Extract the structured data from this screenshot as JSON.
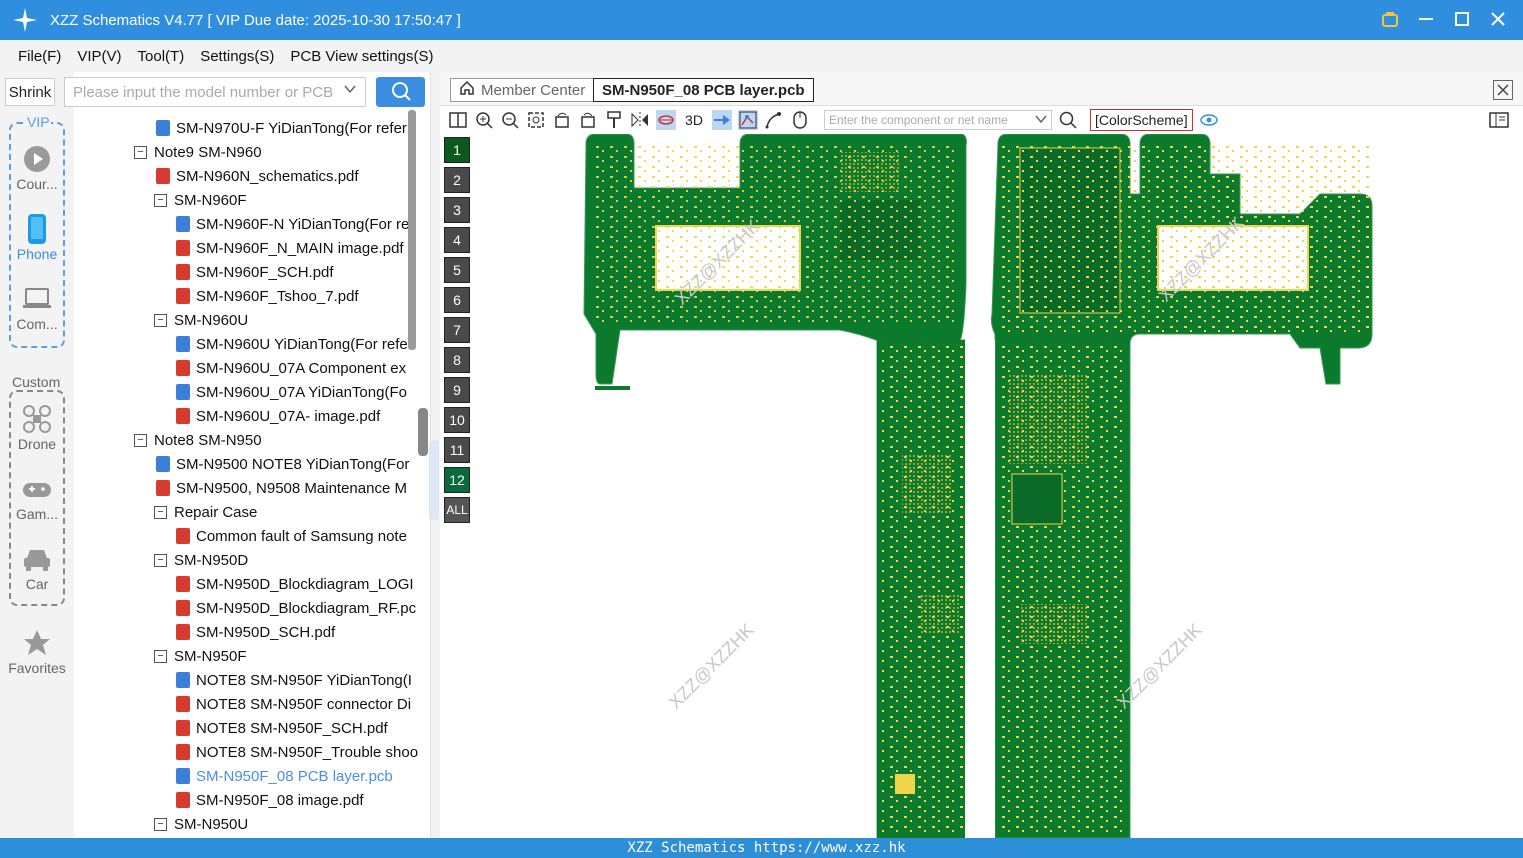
{
  "window": {
    "title": "XZZ Schematics V4.77 [ VIP Due date: 2025-10-30 17:50:47 ]",
    "titlebar_color": "#2f8fde"
  },
  "menu": [
    "File(F)",
    "VIP(V)",
    "Tool(T)",
    "Settings(S)",
    "PCB View settings(S)"
  ],
  "sidebar": {
    "shrink_label": "Shrink",
    "vip_label": "VIP",
    "custom_label": "Custom",
    "items": [
      {
        "label": "Cour...",
        "icon": "play-circle-icon"
      },
      {
        "label": "Phone",
        "icon": "phone-icon",
        "active": true
      },
      {
        "label": "Com...",
        "icon": "laptop-icon"
      },
      {
        "label": "Drone",
        "icon": "drone-icon"
      },
      {
        "label": "Gam...",
        "icon": "gamepad-icon"
      },
      {
        "label": "Car",
        "icon": "car-icon"
      },
      {
        "label": "Favorites",
        "icon": "star-icon"
      }
    ]
  },
  "search": {
    "placeholder": "Please input the model number or PCB"
  },
  "tree": [
    {
      "level": 1,
      "type": "pcb",
      "label": "SM-N970U-F YiDianTong(For refer"
    },
    {
      "level": 0,
      "type": "folder",
      "label": "Note9 SM-N960"
    },
    {
      "level": 1,
      "type": "pdf",
      "label": "SM-N960N_schematics.pdf"
    },
    {
      "level": 1,
      "type": "folder",
      "label": "SM-N960F"
    },
    {
      "level": 2,
      "type": "pcb",
      "label": "SM-N960F-N YiDianTong(For re"
    },
    {
      "level": 2,
      "type": "pdf",
      "label": "SM-N960F_N_MAIN image.pdf"
    },
    {
      "level": 2,
      "type": "pdf",
      "label": "SM-N960F_SCH.pdf"
    },
    {
      "level": 2,
      "type": "pdf",
      "label": "SM-N960F_Tshoo_7.pdf"
    },
    {
      "level": 1,
      "type": "folder",
      "label": "SM-N960U"
    },
    {
      "level": 2,
      "type": "pcb",
      "label": "SM-N960U YiDianTong(For refe"
    },
    {
      "level": 2,
      "type": "pdf",
      "label": "SM-N960U_07A Component ex"
    },
    {
      "level": 2,
      "type": "pcb",
      "label": "SM-N960U_07A YiDianTong(Fo"
    },
    {
      "level": 2,
      "type": "pdf",
      "label": "SM-N960U_07A- image.pdf"
    },
    {
      "level": 0,
      "type": "folder",
      "label": "Note8 SM-N950"
    },
    {
      "level": 1,
      "type": "pcb",
      "label": "SM-N9500 NOTE8 YiDianTong(For"
    },
    {
      "level": 1,
      "type": "pdf",
      "label": "SM-N9500, N9508 Maintenance M"
    },
    {
      "level": 1,
      "type": "folder",
      "label": "Repair Case"
    },
    {
      "level": 2,
      "type": "pdf",
      "label": "Common fault of Samsung note"
    },
    {
      "level": 1,
      "type": "folder",
      "label": "SM-N950D"
    },
    {
      "level": 2,
      "type": "pdf",
      "label": "SM-N950D_Blockdiagram_LOGI"
    },
    {
      "level": 2,
      "type": "pdf",
      "label": "SM-N950D_Blockdiagram_RF.pc"
    },
    {
      "level": 2,
      "type": "pdf",
      "label": "SM-N950D_SCH.pdf"
    },
    {
      "level": 1,
      "type": "folder",
      "label": "SM-N950F"
    },
    {
      "level": 2,
      "type": "pcb",
      "label": "NOTE8 SM-N950F YiDianTong(I"
    },
    {
      "level": 2,
      "type": "pdf",
      "label": "NOTE8 SM-N950F connector Di"
    },
    {
      "level": 2,
      "type": "pdf",
      "label": "NOTE8 SM-N950F_SCH.pdf"
    },
    {
      "level": 2,
      "type": "pdf",
      "label": "NOTE8 SM-N950F_Trouble shoo"
    },
    {
      "level": 2,
      "type": "pcb",
      "label": "SM-N950F_08 PCB layer.pcb",
      "active": true
    },
    {
      "level": 2,
      "type": "pdf",
      "label": "SM-N950F_08 image.pdf"
    },
    {
      "level": 1,
      "type": "folder",
      "label": "SM-N950U"
    }
  ],
  "tabs": {
    "home_label": "Member Center",
    "active_label": "SM-N950F_08 PCB layer.pcb"
  },
  "toolbar": {
    "label_3d": "3D",
    "component_placeholder": "Enter the component or net name",
    "colorscheme_label": "[ColorScheme]"
  },
  "layers": [
    "1",
    "2",
    "3",
    "4",
    "5",
    "6",
    "7",
    "8",
    "9",
    "10",
    "11",
    "12",
    "ALL"
  ],
  "watermark_text": "XZZ@XZZHK",
  "statusbar": {
    "text": "XZZ Schematics https://www.xzz.hk"
  },
  "colors": {
    "pcb_green": "#0b7a2c",
    "pad_yellow": "#f0d44a",
    "accent": "#3b8ee0"
  }
}
